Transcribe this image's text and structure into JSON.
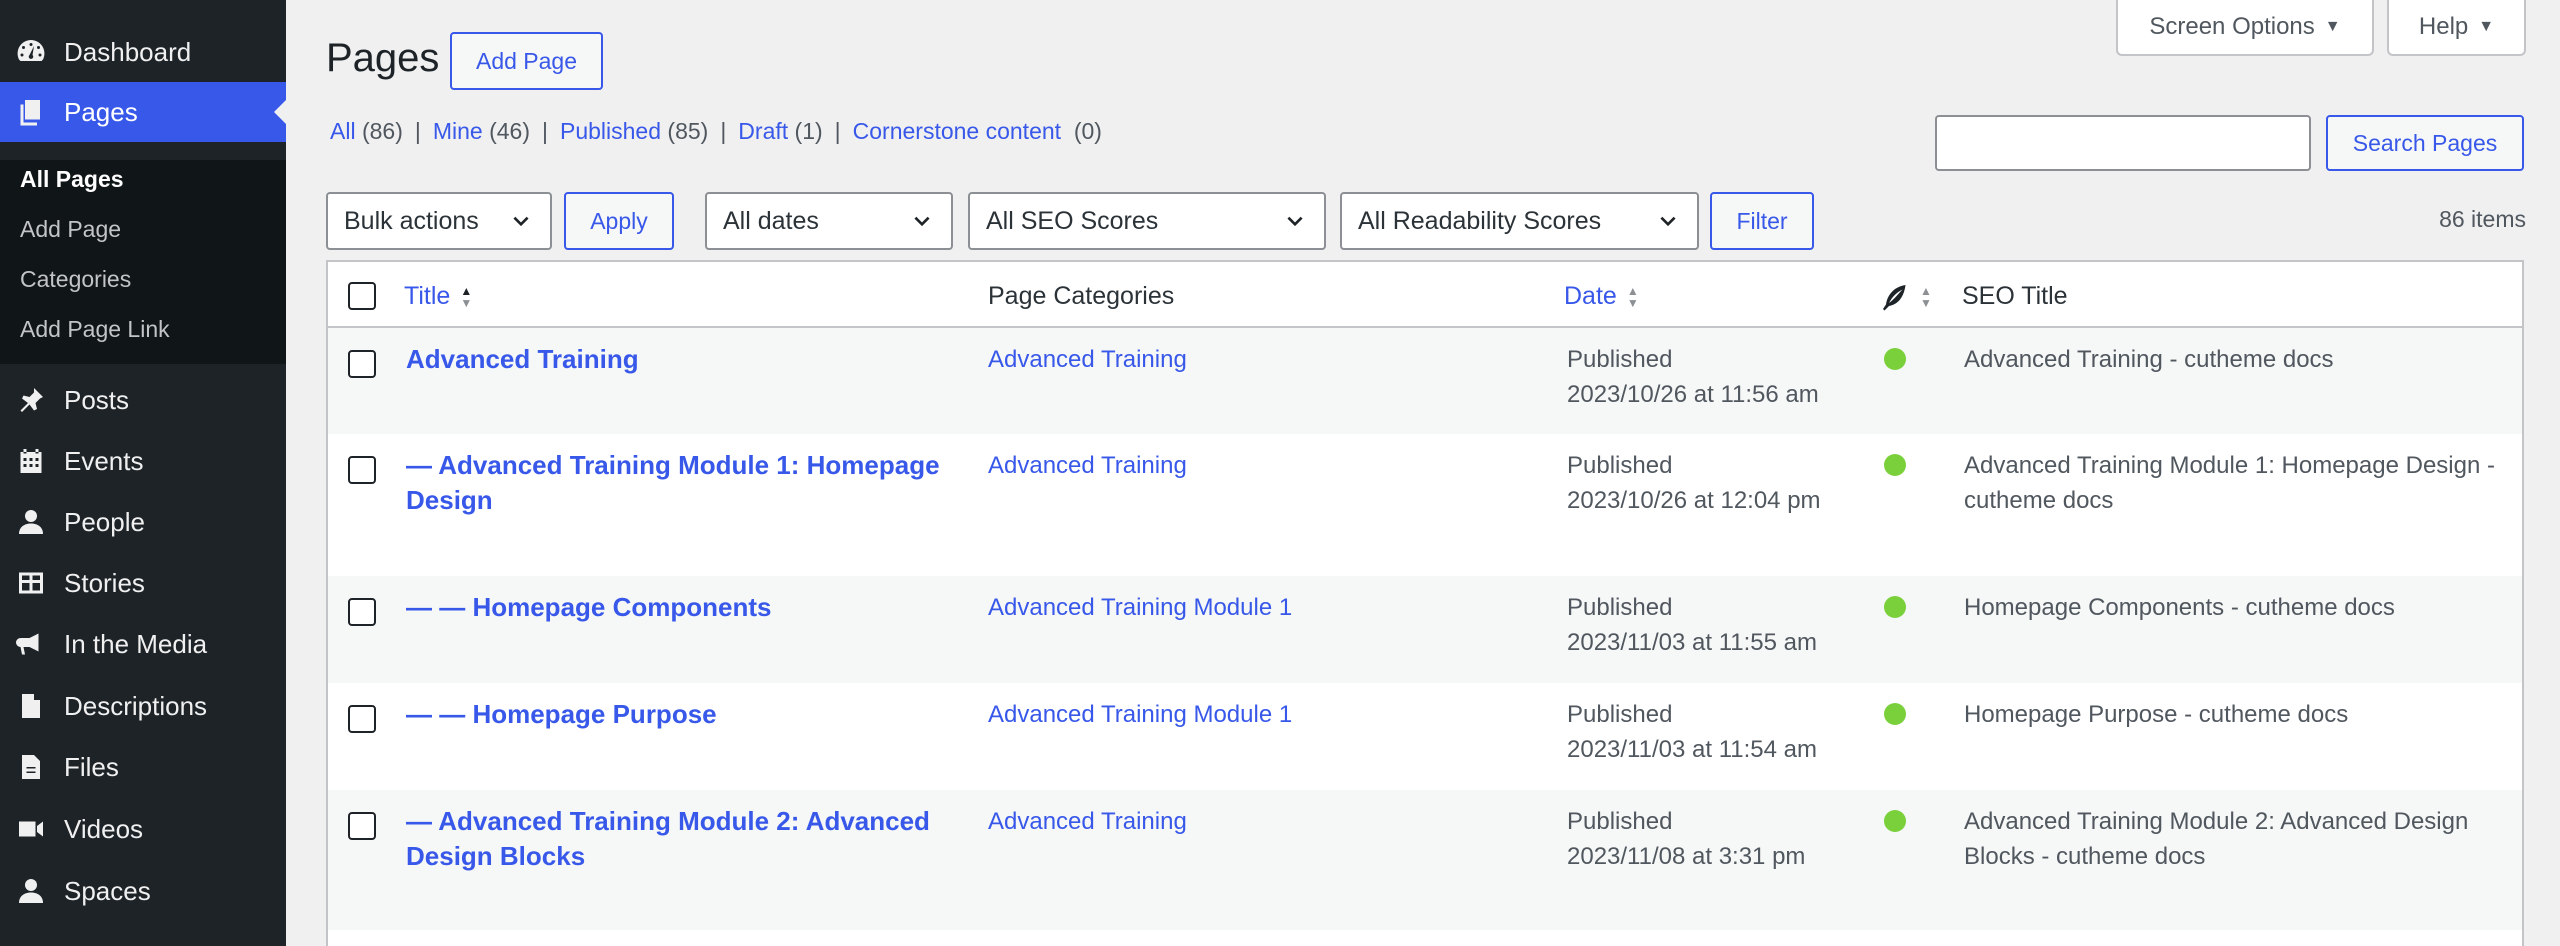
{
  "colors": {
    "accent": "#3858e9",
    "sidebar_bg": "#1d2327",
    "seo_good": "#7ad03a"
  },
  "sidebar": {
    "items": [
      {
        "label": "Dashboard",
        "icon": "dashboard-icon"
      },
      {
        "label": "Pages",
        "icon": "pages-icon",
        "active": true
      },
      {
        "label": "Posts",
        "icon": "pin-icon"
      },
      {
        "label": "Events",
        "icon": "calendar-icon"
      },
      {
        "label": "People",
        "icon": "person-icon"
      },
      {
        "label": "Stories",
        "icon": "grid-icon"
      },
      {
        "label": "In the Media",
        "icon": "megaphone-icon"
      },
      {
        "label": "Descriptions",
        "icon": "document-icon"
      },
      {
        "label": "Files",
        "icon": "file-icon"
      },
      {
        "label": "Videos",
        "icon": "video-icon"
      },
      {
        "label": "Spaces",
        "icon": "person-icon"
      }
    ],
    "submenu": [
      "All Pages",
      "Add Page",
      "Categories",
      "Add Page Link"
    ]
  },
  "header": {
    "title": "Pages",
    "add_page": "Add Page",
    "screen_options": "Screen Options",
    "help": "Help"
  },
  "views": [
    {
      "label": "All",
      "count": "(86)"
    },
    {
      "label": "Mine",
      "count": "(46)"
    },
    {
      "label": "Published",
      "count": "(85)"
    },
    {
      "label": "Draft",
      "count": "(1)"
    },
    {
      "label": "Cornerstone content",
      "count": "(0)"
    }
  ],
  "search": {
    "value": "",
    "button": "Search Pages"
  },
  "filters": {
    "bulk": "Bulk actions",
    "apply": "Apply",
    "dates": "All dates",
    "seo": "All SEO Scores",
    "readability": "All Readability Scores",
    "filter": "Filter"
  },
  "items_count": "86 items",
  "table": {
    "headers": {
      "title": "Title",
      "categories": "Page Categories",
      "date": "Date",
      "seo_title": "SEO Title"
    },
    "rows": [
      {
        "title": "Advanced Training",
        "category": "Advanced Training",
        "status": "Published",
        "date": "2023/10/26 at 11:56 am",
        "seo_title": "Advanced Training - cutheme docs"
      },
      {
        "title": "— Advanced Training Module 1: Homepage Design",
        "category": "Advanced Training",
        "status": "Published",
        "date": "2023/10/26 at 12:04 pm",
        "seo_title": "Advanced Training Module 1: Homepage Design - cutheme docs"
      },
      {
        "title": "— — Homepage Components",
        "category": "Advanced Training Module 1",
        "status": "Published",
        "date": "2023/11/03 at 11:55 am",
        "seo_title": "Homepage Components - cutheme docs"
      },
      {
        "title": "— — Homepage Purpose",
        "category": "Advanced Training Module 1",
        "status": "Published",
        "date": "2023/11/03 at 11:54 am",
        "seo_title": "Homepage Purpose - cutheme docs"
      },
      {
        "title": "— Advanced Training Module 2: Advanced Design Blocks",
        "category": "Advanced Training",
        "status": "Published",
        "date": "2023/11/08 at 3:31 pm",
        "seo_title": "Advanced Training Module 2: Advanced Design Blocks - cutheme docs"
      }
    ]
  }
}
